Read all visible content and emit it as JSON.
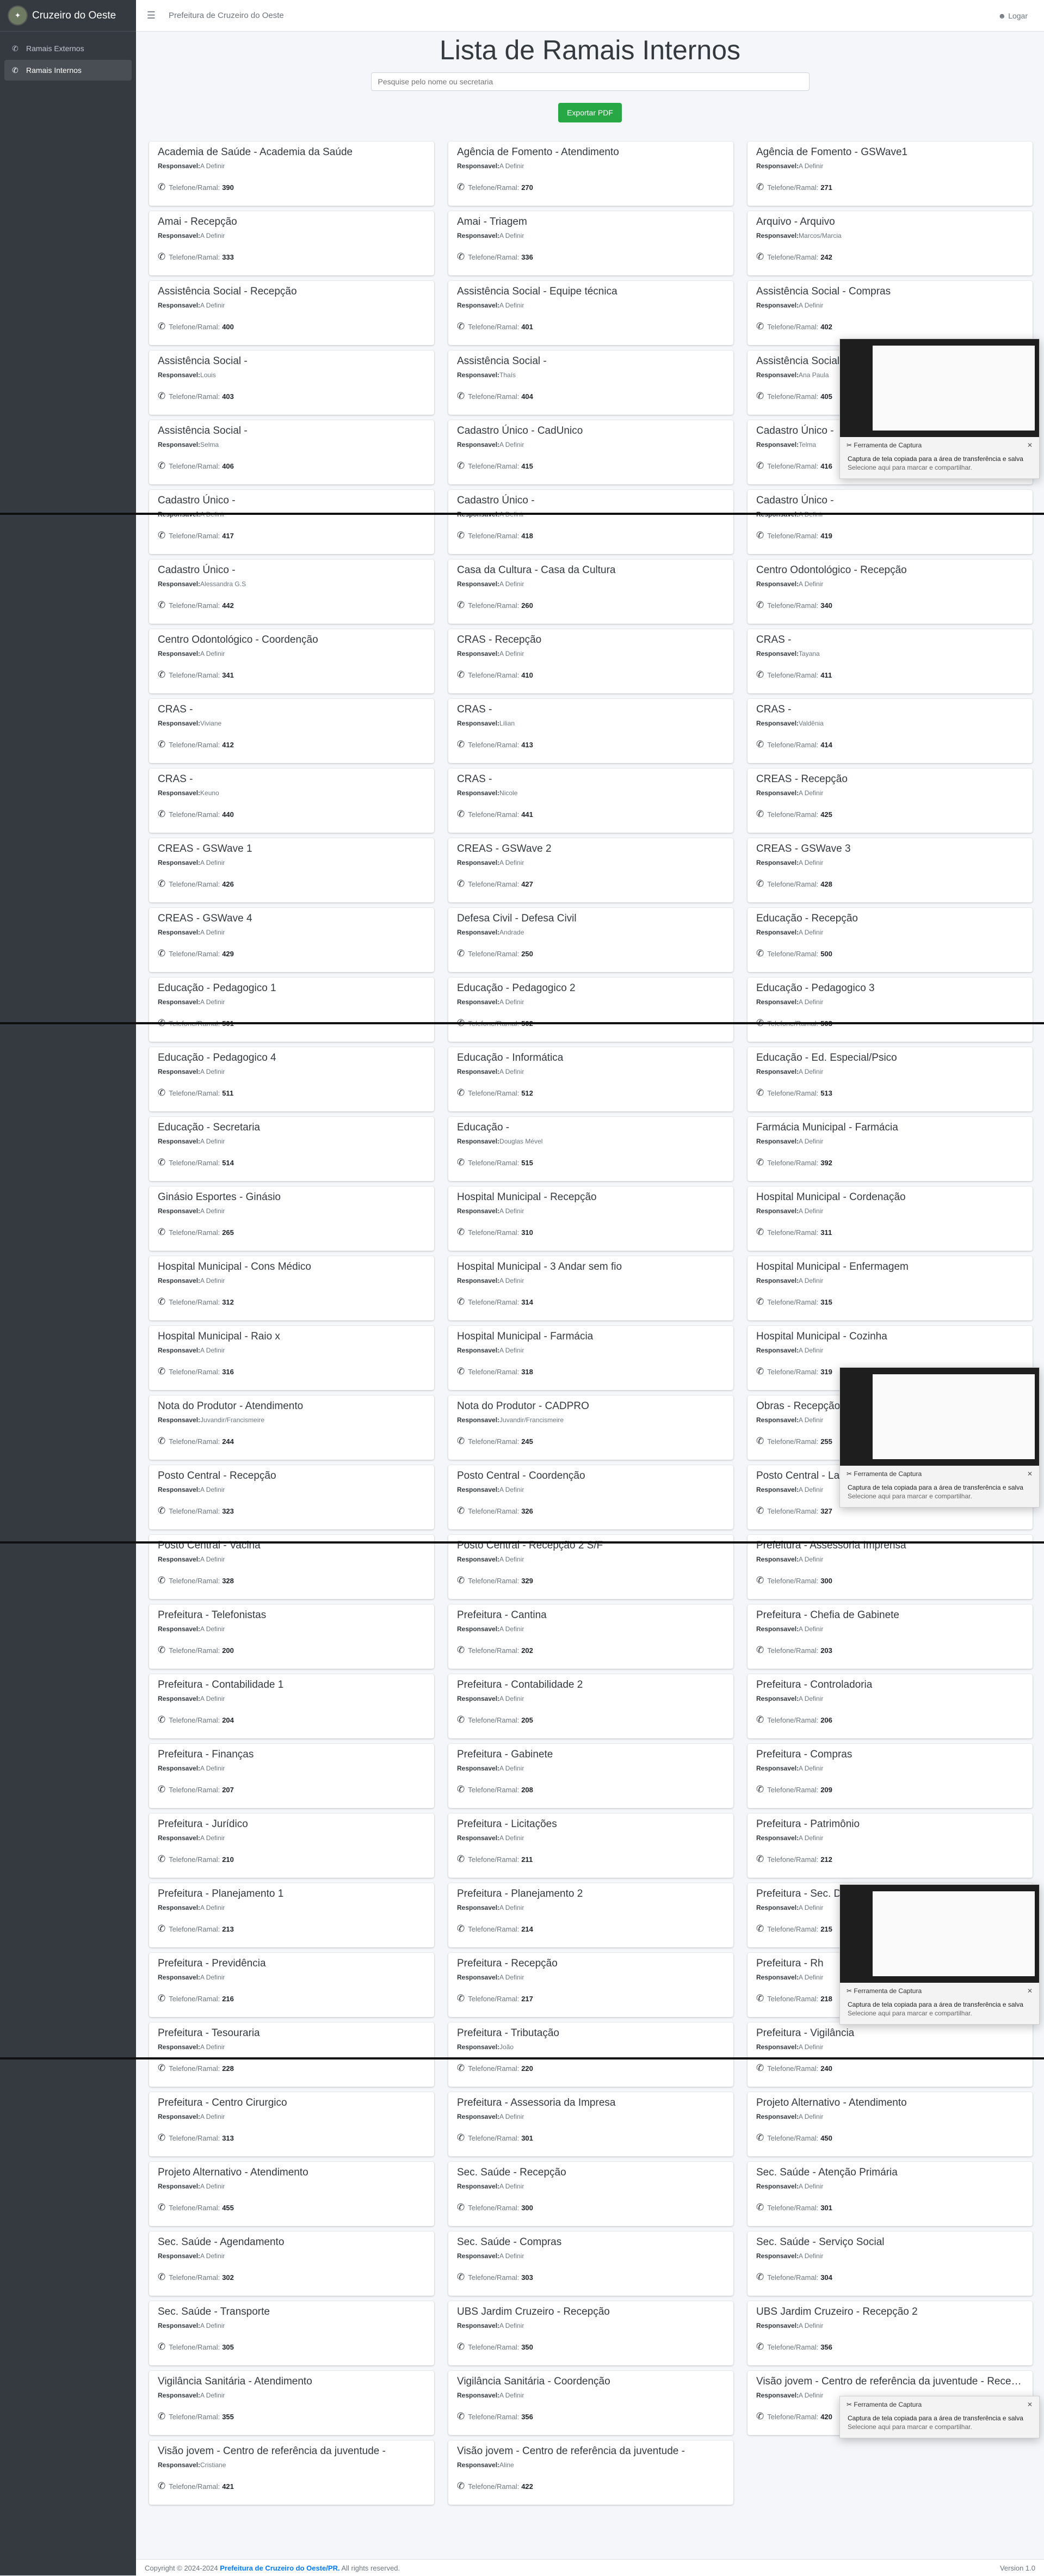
{
  "sidebar": {
    "brand": "Cruzeiro do Oeste",
    "items": [
      {
        "label": "Ramais Externos",
        "active": false
      },
      {
        "label": "Ramais Internos",
        "active": true
      }
    ]
  },
  "topbar": {
    "title": "Prefeitura de Cruzeiro do Oeste",
    "login": "Logar"
  },
  "page": {
    "title": "Lista de Ramais Internos",
    "search_placeholder": "Pesquise pelo nome ou secretaria",
    "export_label": "Exportar PDF",
    "resp_label": "Responsavel:",
    "phone_label": "Telefone/Ramal:"
  },
  "cards": [
    {
      "name": "Academia de Saúde - Academia da Saúde",
      "resp": "A Definir",
      "ramal": "390"
    },
    {
      "name": "Agência de Fomento - Atendimento",
      "resp": "A Definir",
      "ramal": "270"
    },
    {
      "name": "Agência de Fomento - GSWave1",
      "resp": "A Definir",
      "ramal": "271"
    },
    {
      "name": "Amai - Recepção",
      "resp": "A Definir",
      "ramal": "333"
    },
    {
      "name": "Amai - Triagem",
      "resp": "A Definir",
      "ramal": "336"
    },
    {
      "name": "Arquivo - Arquivo",
      "resp": "Marcos/Marcia",
      "ramal": "242"
    },
    {
      "name": "Assistência Social - Recepção",
      "resp": "A Definir",
      "ramal": "400"
    },
    {
      "name": "Assistência Social - Equipe técnica",
      "resp": "A Definir",
      "ramal": "401"
    },
    {
      "name": "Assistência Social - Compras",
      "resp": "A Definir",
      "ramal": "402"
    },
    {
      "name": "Assistência Social -",
      "resp": "Louis",
      "ramal": "403"
    },
    {
      "name": "Assistência Social -",
      "resp": "Thaís",
      "ramal": "404"
    },
    {
      "name": "Assistência Social -",
      "resp": "Ana Paula",
      "ramal": "405"
    },
    {
      "name": "Assistência Social -",
      "resp": "Selma",
      "ramal": "406"
    },
    {
      "name": "Cadastro Único - CadUnico",
      "resp": "A Definir",
      "ramal": "415"
    },
    {
      "name": "Cadastro Único -",
      "resp": "Telma",
      "ramal": "416"
    },
    {
      "name": "Cadastro Único -",
      "resp": "A Definir",
      "ramal": "417"
    },
    {
      "name": "Cadastro Único -",
      "resp": "A Definir",
      "ramal": "418"
    },
    {
      "name": "Cadastro Único -",
      "resp": "A Definir",
      "ramal": "419"
    },
    {
      "name": "Cadastro Único -",
      "resp": "Alessandra G.S",
      "ramal": "442"
    },
    {
      "name": "Casa da Cultura - Casa da Cultura",
      "resp": "A Definir",
      "ramal": "260"
    },
    {
      "name": "Centro Odontológico - Recepção",
      "resp": "A Definir",
      "ramal": "340"
    },
    {
      "name": "Centro Odontológico - Coordenção",
      "resp": "A Definir",
      "ramal": "341"
    },
    {
      "name": "CRAS - Recepção",
      "resp": "A Definir",
      "ramal": "410"
    },
    {
      "name": "CRAS -",
      "resp": "Tayana",
      "ramal": "411"
    },
    {
      "name": "CRAS -",
      "resp": "Viviane",
      "ramal": "412"
    },
    {
      "name": "CRAS -",
      "resp": "Lilian",
      "ramal": "413"
    },
    {
      "name": "CRAS -",
      "resp": "Valdênia",
      "ramal": "414"
    },
    {
      "name": "CRAS -",
      "resp": "Keuno",
      "ramal": "440"
    },
    {
      "name": "CRAS -",
      "resp": "Nicole",
      "ramal": "441"
    },
    {
      "name": "CREAS - Recepção",
      "resp": "A Definir",
      "ramal": "425"
    },
    {
      "name": "CREAS - GSWave 1",
      "resp": "A Definir",
      "ramal": "426"
    },
    {
      "name": "CREAS - GSWave 2",
      "resp": "A Definir",
      "ramal": "427"
    },
    {
      "name": "CREAS - GSWave 3",
      "resp": "A Definir",
      "ramal": "428"
    },
    {
      "name": "CREAS - GSWave 4",
      "resp": "A Definir",
      "ramal": "429"
    },
    {
      "name": "Defesa Civil - Defesa Civil",
      "resp": "Andrade",
      "ramal": "250"
    },
    {
      "name": "Educação - Recepção",
      "resp": "A Definir",
      "ramal": "500"
    },
    {
      "name": "Educação - Pedagogico 1",
      "resp": "A Definir",
      "ramal": "501"
    },
    {
      "name": "Educação - Pedagogico 2",
      "resp": "A Definir",
      "ramal": "502"
    },
    {
      "name": "Educação - Pedagogico 3",
      "resp": "A Definir",
      "ramal": "503"
    },
    {
      "name": "Educação - Pedagogico 4",
      "resp": "A Definir",
      "ramal": "511"
    },
    {
      "name": "Educação - Informática",
      "resp": "A Definir",
      "ramal": "512"
    },
    {
      "name": "Educação - Ed. Especial/Psico",
      "resp": "A Definir",
      "ramal": "513"
    },
    {
      "name": "Educação - Secretaria",
      "resp": "A Definir",
      "ramal": "514"
    },
    {
      "name": "Educação -",
      "resp": "Douglas Mével",
      "ramal": "515"
    },
    {
      "name": "Farmácia Municipal - Farmácia",
      "resp": "A Definir",
      "ramal": "392"
    },
    {
      "name": "Ginásio Esportes - Ginásio",
      "resp": "A Definir",
      "ramal": "265"
    },
    {
      "name": "Hospital Municipal - Recepção",
      "resp": "A Definir",
      "ramal": "310"
    },
    {
      "name": "Hospital Municipal - Cordenação",
      "resp": "A Definir",
      "ramal": "311"
    },
    {
      "name": "Hospital Municipal - Cons Médico",
      "resp": "A Definir",
      "ramal": "312"
    },
    {
      "name": "Hospital Municipal - 3 Andar sem fio",
      "resp": "A Definir",
      "ramal": "314"
    },
    {
      "name": "Hospital Municipal - Enfermagem",
      "resp": "A Definir",
      "ramal": "315"
    },
    {
      "name": "Hospital Municipal - Raio x",
      "resp": "A Definir",
      "ramal": "316"
    },
    {
      "name": "Hospital Municipal - Farmácia",
      "resp": "A Definir",
      "ramal": "318"
    },
    {
      "name": "Hospital Municipal - Cozinha",
      "resp": "A Definir",
      "ramal": "319"
    },
    {
      "name": "Nota do Produtor - Atendimento",
      "resp": "Juvandir/Francismeire",
      "ramal": "244"
    },
    {
      "name": "Nota do Produtor - CADPRO",
      "resp": "Juvandir/Francismeire",
      "ramal": "245"
    },
    {
      "name": "Obras - Recepção",
      "resp": "A Definir",
      "ramal": "255"
    },
    {
      "name": "Posto Central - Recepção",
      "resp": "A Definir",
      "ramal": "323"
    },
    {
      "name": "Posto Central - Coordenção",
      "resp": "A Definir",
      "ramal": "326"
    },
    {
      "name": "Posto Central - Laboratório",
      "resp": "A Definir",
      "ramal": "327"
    },
    {
      "name": "Posto Central - Vacina",
      "resp": "A Definir",
      "ramal": "328"
    },
    {
      "name": "Posto Central - Recepção 2 S/F",
      "resp": "A Definir",
      "ramal": "329"
    },
    {
      "name": "Prefeitura - Assessoria Imprensa",
      "resp": "A Definir",
      "ramal": "300"
    },
    {
      "name": "Prefeitura - Telefonistas",
      "resp": "A Definir",
      "ramal": "200"
    },
    {
      "name": "Prefeitura - Cantina",
      "resp": "A Definir",
      "ramal": "202"
    },
    {
      "name": "Prefeitura - Chefia de Gabinete",
      "resp": "A Definir",
      "ramal": "203"
    },
    {
      "name": "Prefeitura - Contabilidade 1",
      "resp": "A Definir",
      "ramal": "204"
    },
    {
      "name": "Prefeitura - Contabilidade 2",
      "resp": "A Definir",
      "ramal": "205"
    },
    {
      "name": "Prefeitura - Controladoria",
      "resp": "A Definir",
      "ramal": "206"
    },
    {
      "name": "Prefeitura - Finanças",
      "resp": "A Definir",
      "ramal": "207"
    },
    {
      "name": "Prefeitura - Gabinete",
      "resp": "A Definir",
      "ramal": "208"
    },
    {
      "name": "Prefeitura - Compras",
      "resp": "A Definir",
      "ramal": "209"
    },
    {
      "name": "Prefeitura - Jurídico",
      "resp": "A Definir",
      "ramal": "210"
    },
    {
      "name": "Prefeitura - Licitações",
      "resp": "A Definir",
      "ramal": "211"
    },
    {
      "name": "Prefeitura - Patrimônio",
      "resp": "A Definir",
      "ramal": "212"
    },
    {
      "name": "Prefeitura - Planejamento 1",
      "resp": "A Definir",
      "ramal": "213"
    },
    {
      "name": "Prefeitura - Planejamento 2",
      "resp": "A Definir",
      "ramal": "214"
    },
    {
      "name": "Prefeitura - Sec. Desenvolvimento",
      "resp": "A Definir",
      "ramal": "215"
    },
    {
      "name": "Prefeitura - Previdência",
      "resp": "A Definir",
      "ramal": "216"
    },
    {
      "name": "Prefeitura - Recepção",
      "resp": "A Definir",
      "ramal": "217"
    },
    {
      "name": "Prefeitura - Rh",
      "resp": "A Definir",
      "ramal": "218"
    },
    {
      "name": "Prefeitura - Tesouraria",
      "resp": "A Definir",
      "ramal": "228"
    },
    {
      "name": "Prefeitura - Tributação",
      "resp": "João",
      "ramal": "220"
    },
    {
      "name": "Prefeitura - Vigilância",
      "resp": "A Definir",
      "ramal": "240"
    },
    {
      "name": "Prefeitura - Centro Cirurgico",
      "resp": "A Definir",
      "ramal": "313"
    },
    {
      "name": "Prefeitura - Assessoria da Impresa",
      "resp": "A Definir",
      "ramal": "301"
    },
    {
      "name": "Projeto Alternativo - Atendimento",
      "resp": "A Definir",
      "ramal": "450"
    },
    {
      "name": "Projeto Alternativo - Atendimento",
      "resp": "A Definir",
      "ramal": "455"
    },
    {
      "name": "Sec. Saúde - Recepção",
      "resp": "A Definir",
      "ramal": "300"
    },
    {
      "name": "Sec. Saúde - Atenção Primária",
      "resp": "A Definir",
      "ramal": "301"
    },
    {
      "name": "Sec. Saúde - Agendamento",
      "resp": "A Definir",
      "ramal": "302"
    },
    {
      "name": "Sec. Saúde - Compras",
      "resp": "A Definir",
      "ramal": "303"
    },
    {
      "name": "Sec. Saúde - Serviço Social",
      "resp": "A Definir",
      "ramal": "304"
    },
    {
      "name": "Sec. Saúde - Transporte",
      "resp": "A Definir",
      "ramal": "305"
    },
    {
      "name": "UBS Jardim Cruzeiro - Recepção",
      "resp": "A Definir",
      "ramal": "350"
    },
    {
      "name": "UBS Jardim Cruzeiro - Recepção 2",
      "resp": "A Definir",
      "ramal": "356"
    },
    {
      "name": "Vigilância Sanitária - Atendimento",
      "resp": "A Definir",
      "ramal": "355"
    },
    {
      "name": "Vigilância Sanitária - Coordenção",
      "resp": "A Definir",
      "ramal": "356"
    },
    {
      "name": "Visão jovem - Centro de referência da juventude - Recepção",
      "resp": "A Definir",
      "ramal": "420"
    },
    {
      "name": "Visão jovem - Centro de referência da juventude -",
      "resp": "Cristiane",
      "ramal": "421"
    },
    {
      "name": "Visão jovem - Centro de referência da juventude -",
      "resp": "Aline",
      "ramal": "422"
    }
  ],
  "footer": {
    "copyright": "Copyright © 2024-2024",
    "org": "Prefeitura de Cruzeiro do Oeste/PR.",
    "rights": "All rights reserved.",
    "version": "Version 1.0"
  },
  "toast": {
    "title": "Ferramenta de Captura",
    "line1": "Captura de tela copiada para a área de transferência e salva",
    "line2": "Selecione aqui para marcar e compartilhar."
  }
}
